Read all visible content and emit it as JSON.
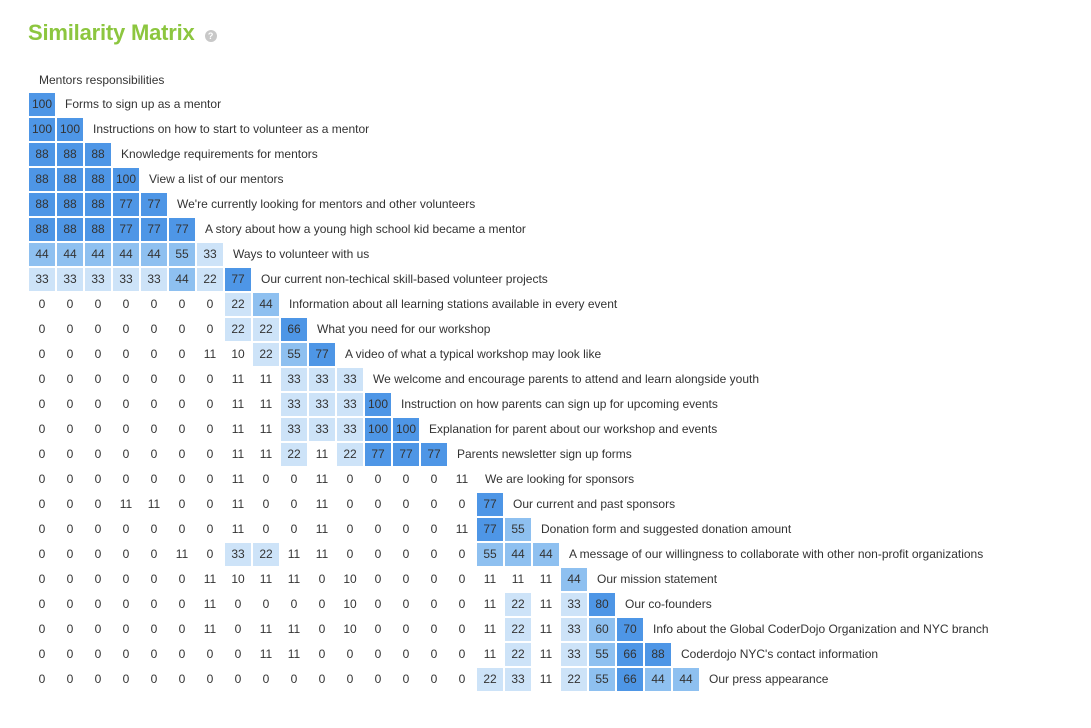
{
  "page": {
    "title": "Similarity Matrix",
    "help_icon": "question-circle-icon"
  },
  "matrix": {
    "top_label": "Mentors responsibilities",
    "colors": {
      "high": "#4e96e6",
      "mid": "#8ec0f0",
      "low": "#cde3f8",
      "none": "#ffffff"
    },
    "rows": [
      {
        "label": "Forms to sign up as a mentor",
        "values": [
          100
        ]
      },
      {
        "label": "Instructions on how to start to volunteer as a mentor",
        "values": [
          100,
          100
        ]
      },
      {
        "label": "Knowledge requirements for mentors",
        "values": [
          88,
          88,
          88
        ]
      },
      {
        "label": "View a list of our mentors",
        "values": [
          88,
          88,
          88,
          100
        ]
      },
      {
        "label": "We're currently looking for mentors and other volunteers",
        "values": [
          88,
          88,
          88,
          77,
          77
        ]
      },
      {
        "label": "A story about how a young high school kid became a mentor",
        "values": [
          88,
          88,
          88,
          77,
          77,
          77
        ]
      },
      {
        "label": "Ways to volunteer with us",
        "values": [
          44,
          44,
          44,
          44,
          44,
          55,
          33
        ]
      },
      {
        "label": "Our current non-techical skill-based volunteer projects",
        "values": [
          33,
          33,
          33,
          33,
          33,
          44,
          22,
          77
        ]
      },
      {
        "label": "Information about all learning stations available in every event",
        "values": [
          0,
          0,
          0,
          0,
          0,
          0,
          0,
          22,
          44
        ]
      },
      {
        "label": "What you need for our workshop",
        "values": [
          0,
          0,
          0,
          0,
          0,
          0,
          0,
          22,
          22,
          66
        ]
      },
      {
        "label": "A video of what a typical workshop may look like",
        "values": [
          0,
          0,
          0,
          0,
          0,
          0,
          11,
          10,
          22,
          55,
          77
        ]
      },
      {
        "label": "We welcome and encourage parents to attend and learn alongside youth",
        "values": [
          0,
          0,
          0,
          0,
          0,
          0,
          0,
          11,
          11,
          33,
          33,
          33
        ]
      },
      {
        "label": "Instruction on how parents can sign up for upcoming events",
        "values": [
          0,
          0,
          0,
          0,
          0,
          0,
          0,
          11,
          11,
          33,
          33,
          33,
          100
        ]
      },
      {
        "label": "Explanation for parent about our workshop and events",
        "values": [
          0,
          0,
          0,
          0,
          0,
          0,
          0,
          11,
          11,
          33,
          33,
          33,
          100,
          100
        ]
      },
      {
        "label": "Parents newsletter sign up forms",
        "values": [
          0,
          0,
          0,
          0,
          0,
          0,
          0,
          11,
          11,
          22,
          11,
          22,
          77,
          77,
          77
        ]
      },
      {
        "label": "We are looking for sponsors",
        "values": [
          0,
          0,
          0,
          0,
          0,
          0,
          0,
          11,
          0,
          0,
          11,
          0,
          0,
          0,
          0,
          11
        ]
      },
      {
        "label": "Our current and past sponsors",
        "values": [
          0,
          0,
          0,
          11,
          11,
          0,
          0,
          11,
          0,
          0,
          11,
          0,
          0,
          0,
          0,
          0,
          77
        ]
      },
      {
        "label": "Donation form and suggested donation amount",
        "values": [
          0,
          0,
          0,
          0,
          0,
          0,
          0,
          11,
          0,
          0,
          11,
          0,
          0,
          0,
          0,
          11,
          77,
          55
        ]
      },
      {
        "label": "A message of our willingness to collaborate with other non-profit organizations",
        "values": [
          0,
          0,
          0,
          0,
          0,
          11,
          0,
          33,
          22,
          11,
          11,
          0,
          0,
          0,
          0,
          0,
          55,
          44,
          44
        ]
      },
      {
        "label": "Our mission statement",
        "values": [
          0,
          0,
          0,
          0,
          0,
          0,
          11,
          10,
          11,
          11,
          0,
          10,
          0,
          0,
          0,
          0,
          11,
          11,
          11,
          44
        ]
      },
      {
        "label": "Our co-founders",
        "values": [
          0,
          0,
          0,
          0,
          0,
          0,
          11,
          0,
          0,
          0,
          0,
          10,
          0,
          0,
          0,
          0,
          11,
          22,
          11,
          33,
          80
        ]
      },
      {
        "label": "Info about the Global CoderDojo Organization and NYC branch",
        "values": [
          0,
          0,
          0,
          0,
          0,
          0,
          11,
          0,
          11,
          11,
          0,
          10,
          0,
          0,
          0,
          0,
          11,
          22,
          11,
          33,
          60,
          70
        ]
      },
      {
        "label": "Coderdojo NYC's contact information",
        "values": [
          0,
          0,
          0,
          0,
          0,
          0,
          0,
          0,
          11,
          11,
          0,
          0,
          0,
          0,
          0,
          0,
          11,
          22,
          11,
          33,
          55,
          66,
          88
        ]
      },
      {
        "label": "Our press appearance",
        "values": [
          0,
          0,
          0,
          0,
          0,
          0,
          0,
          0,
          0,
          0,
          0,
          0,
          0,
          0,
          0,
          0,
          22,
          33,
          11,
          22,
          55,
          66,
          44,
          44
        ]
      }
    ]
  }
}
